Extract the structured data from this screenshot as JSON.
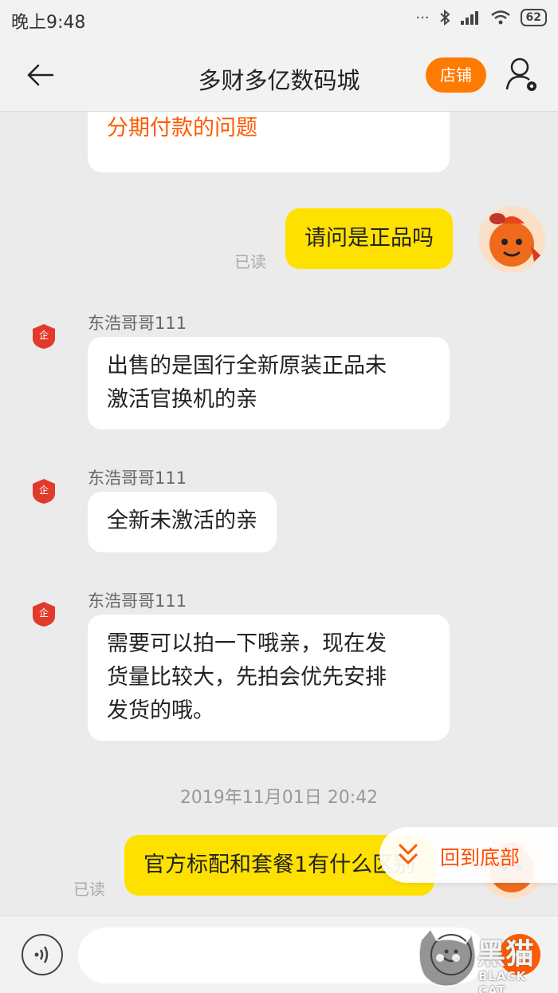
{
  "status_bar": {
    "time": "晚上9:48",
    "battery": "62"
  },
  "header": {
    "title": "多财多亿数码城",
    "shop_label": "店铺"
  },
  "messages": [
    {
      "text": "分期付款的问题"
    },
    {
      "text": "请问是正品吗",
      "read": "已读"
    },
    {
      "sender": "东浩哥哥111",
      "lines": [
        "出售的是国行全新原装正品未",
        "激活官换机的亲"
      ]
    },
    {
      "sender": "东浩哥哥111",
      "lines": [
        "全新未激活的亲"
      ]
    },
    {
      "sender": "东浩哥哥111",
      "lines": [
        "需要可以拍一下哦亲，现在发",
        "货量比较大，先拍会优先安排",
        "发货的哦。"
      ]
    },
    {
      "timestamp": "2019年11月01日 20:42"
    },
    {
      "text": "官方标配和套餐1有什么区别",
      "read": "已读"
    }
  ],
  "return_bottom": "回到底部",
  "watermark": {
    "brand": "黑猫",
    "sub": "BLACK CAT"
  },
  "colors": {
    "accent": "#ff7a00",
    "bubble_self": "#ffe100",
    "link_orange": "#ff5a00"
  }
}
